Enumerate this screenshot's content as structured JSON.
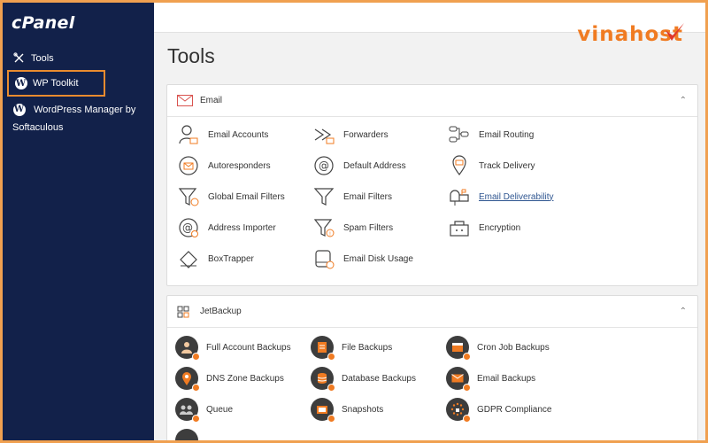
{
  "sidebar": {
    "logo": "cPanel",
    "items": [
      {
        "label": "Tools"
      },
      {
        "label": "WP Toolkit"
      },
      {
        "label": "WordPress Manager by Softaculous"
      }
    ]
  },
  "brand": {
    "text": "vinahost",
    "color": "#f07b22"
  },
  "page": {
    "title": "Tools"
  },
  "email_panel": {
    "title": "Email",
    "tools": [
      {
        "label": "Email Accounts",
        "icon": "email-accounts-icon"
      },
      {
        "label": "Forwarders",
        "icon": "forwarders-icon"
      },
      {
        "label": "Email Routing",
        "icon": "email-routing-icon"
      },
      {
        "label": "Autoresponders",
        "icon": "autoresponders-icon"
      },
      {
        "label": "Default Address",
        "icon": "default-address-icon"
      },
      {
        "label": "Track Delivery",
        "icon": "track-delivery-icon"
      },
      {
        "label": "Global Email Filters",
        "icon": "global-email-filters-icon"
      },
      {
        "label": "Email Filters",
        "icon": "email-filters-icon"
      },
      {
        "label": "Email Deliverability",
        "icon": "email-deliverability-icon"
      },
      {
        "label": "Address Importer",
        "icon": "address-importer-icon"
      },
      {
        "label": "Spam Filters",
        "icon": "spam-filters-icon"
      },
      {
        "label": "Encryption",
        "icon": "encryption-icon"
      },
      {
        "label": "BoxTrapper",
        "icon": "boxtrapper-icon"
      },
      {
        "label": "Email Disk Usage",
        "icon": "email-disk-usage-icon"
      }
    ]
  },
  "jet_panel": {
    "title": "JetBackup",
    "tools": [
      {
        "label": "Full Account Backups",
        "icon": "full-account-backups-icon"
      },
      {
        "label": "File Backups",
        "icon": "file-backups-icon"
      },
      {
        "label": "Cron Job Backups",
        "icon": "cron-job-backups-icon"
      },
      {
        "label": "DNS Zone Backups",
        "icon": "dns-zone-backups-icon"
      },
      {
        "label": "Database Backups",
        "icon": "database-backups-icon"
      },
      {
        "label": "Email Backups",
        "icon": "email-backups-icon"
      },
      {
        "label": "Queue",
        "icon": "queue-icon"
      },
      {
        "label": "Snapshots",
        "icon": "snapshots-icon"
      },
      {
        "label": "GDPR Compliance",
        "icon": "gdpr-compliance-icon"
      }
    ]
  },
  "colors": {
    "sidebar": "#12214a",
    "accent": "#f07b22",
    "highlight": "#e98b2f"
  }
}
